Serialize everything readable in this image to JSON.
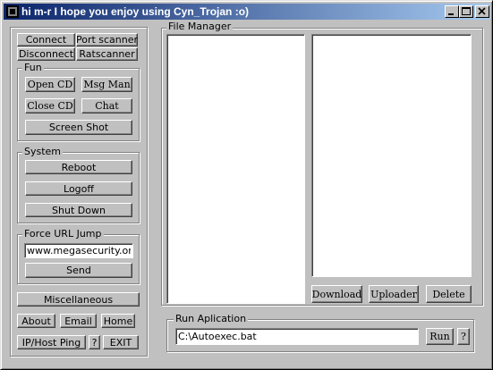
{
  "window": {
    "title": "hi m-r I hope you enjoy using Cyn_Trojan :o)",
    "controls": {
      "minimize": "_",
      "maximize": "□",
      "close": "×"
    }
  },
  "connection": {
    "connect": "Connect",
    "port_scanner": "Port scanner",
    "disconnect": "Disconnect",
    "ratscanner": "Ratscanner"
  },
  "fun": {
    "label": "Fun",
    "open_cd": "Open CD",
    "msg_man": "Msg Man",
    "close_cd": "Close CD",
    "chat": "Chat",
    "screen_shot": "Screen Shot"
  },
  "system": {
    "label": "System",
    "reboot": "Reboot",
    "logoff": "Logoff",
    "shut_down": "Shut Down"
  },
  "force_url": {
    "label": "Force URL Jump",
    "url_value": "www.megasecurity.org",
    "send": "Send"
  },
  "misc": {
    "miscellaneous": "Miscellaneous",
    "about": "About",
    "email": "Email",
    "home": "Home",
    "ip_host_ping": "IP/Host Ping",
    "help": "?",
    "exit": "EXIT"
  },
  "file_manager": {
    "label": "File Manager",
    "download": "Download",
    "uploader": "Uploader",
    "delete": "Delete"
  },
  "run_application": {
    "label": "Run Aplication",
    "path_value": "C:\\Autoexec.bat",
    "run": "Run",
    "help": "?"
  },
  "colors": {
    "title_start": "#0a246a",
    "title_end": "#a6caf0",
    "face": "#c0c0c0"
  }
}
